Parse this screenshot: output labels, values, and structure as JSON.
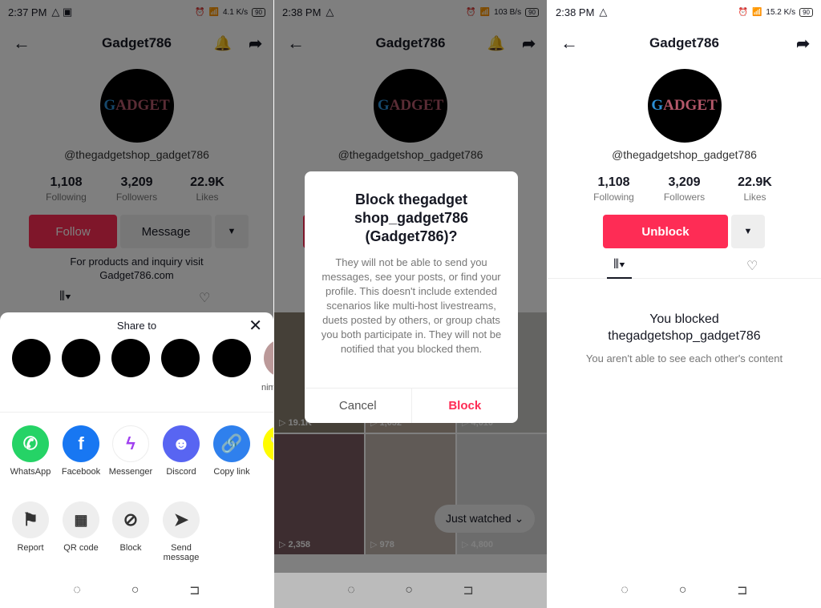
{
  "profile": {
    "title": "Gadget786",
    "handle": "@thegadgetshop_gadget786",
    "following": "1,108",
    "following_label": "Following",
    "followers": "3,209",
    "followers_label": "Followers",
    "likes": "22.9K",
    "likes_label": "Likes",
    "follow": "Follow",
    "message": "Message",
    "bio1": "For products and inquiry visit",
    "bio2": "Gadget786.com",
    "avatar_text": "GADGET 786"
  },
  "panels": [
    {
      "time": "2:37 PM",
      "speed": "4.1 K/s",
      "battery": "90"
    },
    {
      "time": "2:38 PM",
      "speed": "103 B/s",
      "battery": "90"
    },
    {
      "time": "2:38 PM",
      "speed": "15.2 K/s",
      "battery": "90"
    }
  ],
  "share": {
    "title": "Share to",
    "contact_partial": "nim",
    "apps": [
      {
        "label": "WhatsApp",
        "color": "#25d366"
      },
      {
        "label": "Facebook",
        "color": "#1877f2"
      },
      {
        "label": "Messenger",
        "color": "#ffffff"
      },
      {
        "label": "Discord",
        "color": "#5865f2"
      },
      {
        "label": "Copy link",
        "color": "#2f80ed"
      },
      {
        "label": "Sn",
        "color": "#fffc00"
      }
    ],
    "actions": [
      {
        "label": "Report"
      },
      {
        "label": "QR code"
      },
      {
        "label": "Block"
      },
      {
        "label": "Send message"
      }
    ]
  },
  "dialog": {
    "title": "Block thegadget shop_gadget786 (Gadget786)?",
    "body": "They will not be able to send you messages, see your posts, or find your profile. This doesn't include extended scenarios like multi-host livestreams, duets posted by others, or group chats you both participate in. They will not be notified that you blocked them.",
    "cancel": "Cancel",
    "block": "Block",
    "block_color": "#fe2c55"
  },
  "videos": [
    "19.1K",
    "1,032",
    "4,010",
    "2,358",
    "978",
    "4,800"
  ],
  "just_watched": "Just watched",
  "blocked": {
    "unblock": "Unblock",
    "line1": "You blocked",
    "line2": "thegadgetshop_gadget786",
    "sub": "You aren't able to see each other's content"
  },
  "accent": "#fe2c55"
}
